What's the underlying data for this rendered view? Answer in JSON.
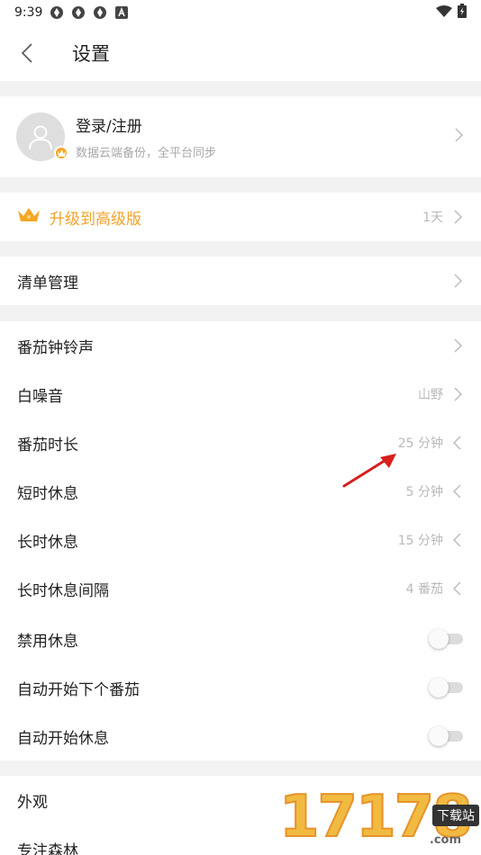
{
  "status_bar": {
    "time": "9:39",
    "icons": [
      "app-notification-icon",
      "app-notification-icon",
      "app-notification-icon",
      "font-a-icon"
    ],
    "right_icons": [
      "wifi-icon",
      "battery-charging-icon"
    ]
  },
  "app_bar": {
    "title": "设置"
  },
  "account": {
    "title": "登录/注册",
    "subtitle": "数据云端备份，全平台同步"
  },
  "premium": {
    "label": "升级到高级版",
    "value": "1天",
    "accent": "#f0a32b"
  },
  "list_manage": {
    "label": "清单管理"
  },
  "timer_settings": [
    {
      "label": "番茄钟铃声",
      "value": "",
      "control": "chevron-right"
    },
    {
      "label": "白噪音",
      "value": "山野",
      "control": "chevron-right"
    },
    {
      "label": "番茄时长",
      "value": "25 分钟",
      "control": "chevron-left"
    },
    {
      "label": "短时休息",
      "value": "5 分钟",
      "control": "chevron-left"
    },
    {
      "label": "长时休息",
      "value": "15 分钟",
      "control": "chevron-left"
    },
    {
      "label": "长时休息间隔",
      "value": "4 番茄",
      "control": "chevron-left"
    },
    {
      "label": "禁用休息",
      "control": "toggle",
      "on": false
    },
    {
      "label": "自动开始下个番茄",
      "control": "toggle",
      "on": false
    },
    {
      "label": "自动开始休息",
      "control": "toggle",
      "on": false
    }
  ],
  "appearance": {
    "label": "外观"
  },
  "forest": {
    "label": "专注森林"
  },
  "annotation": {
    "arrow_color": "#d81e1e"
  },
  "watermark": {
    "digits": "17178",
    "tag": "下载站",
    "suffix": ".com"
  }
}
